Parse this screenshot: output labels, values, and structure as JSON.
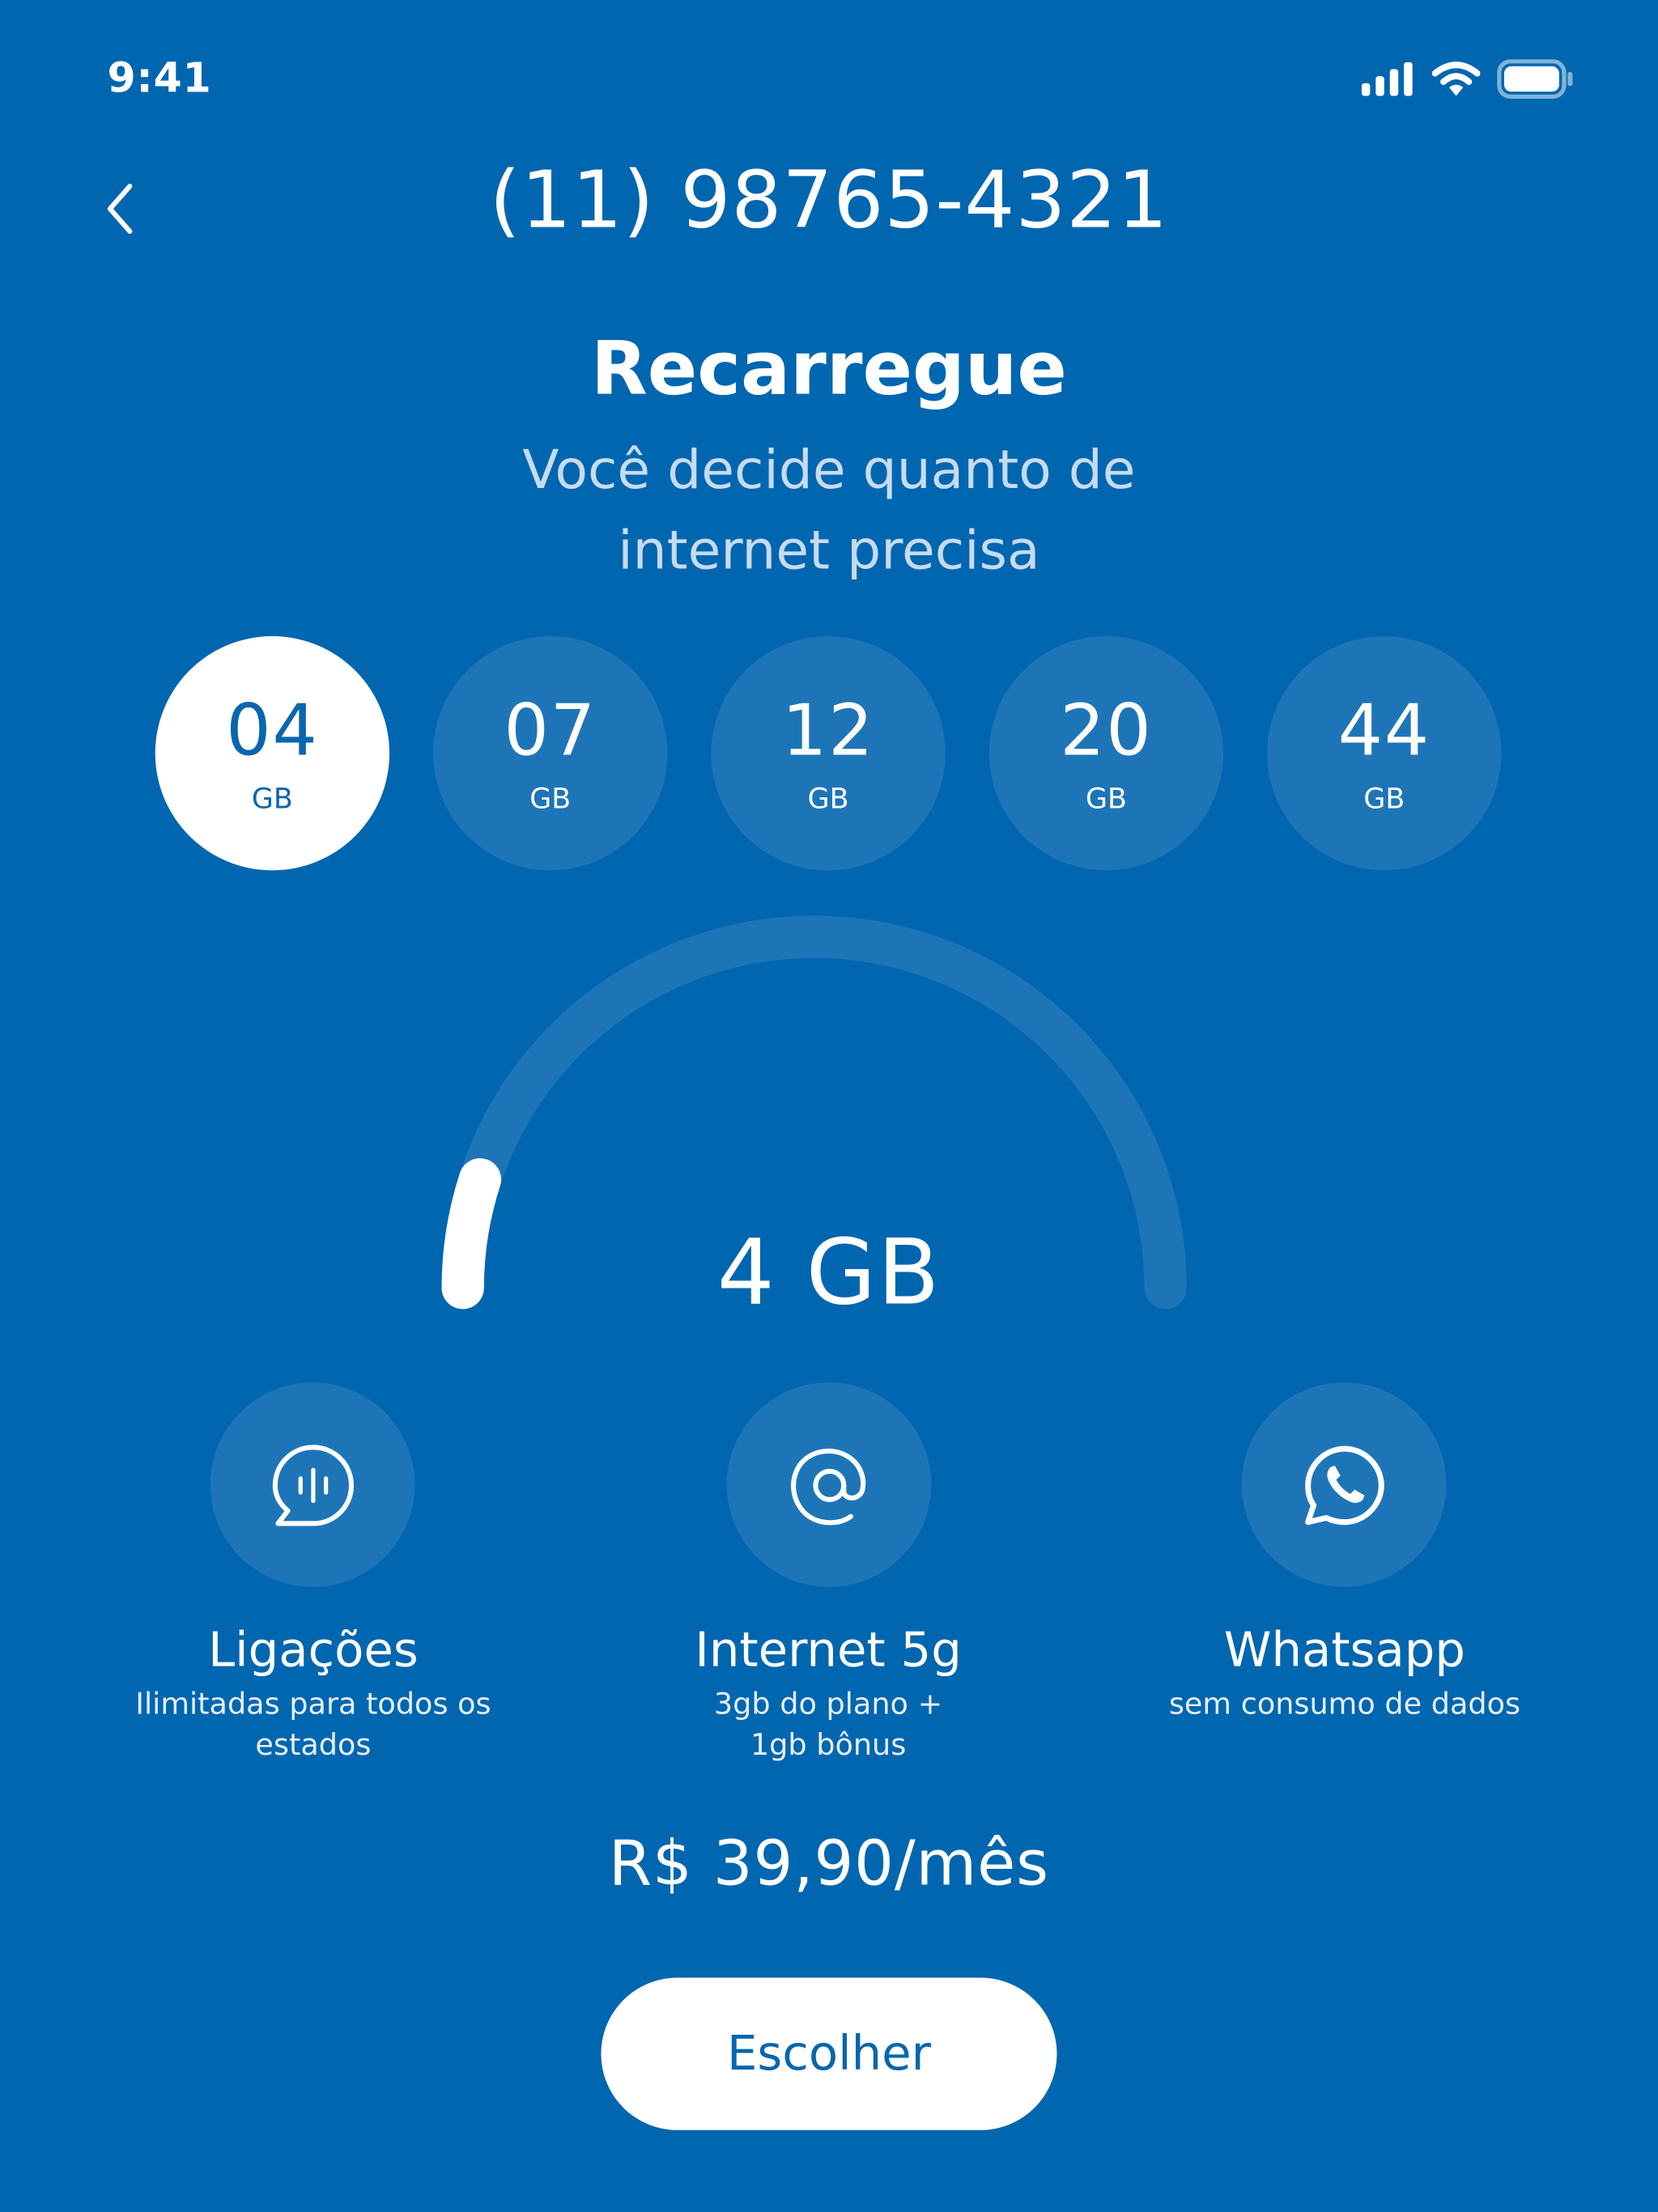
{
  "status_bar": {
    "time": "9:41"
  },
  "header": {
    "title": "(11) 98765-4321"
  },
  "hero": {
    "title": "Recarregue",
    "subtitle": "Você decide quanto de internet precisa"
  },
  "gb_options": [
    {
      "value": "04",
      "unit": "GB",
      "selected": true
    },
    {
      "value": "07",
      "unit": "GB",
      "selected": false
    },
    {
      "value": "12",
      "unit": "GB",
      "selected": false
    },
    {
      "value": "20",
      "unit": "GB",
      "selected": false
    },
    {
      "value": "44",
      "unit": "GB",
      "selected": false
    }
  ],
  "gauge": {
    "value_label": "4 GB",
    "fill_fraction": 0.1
  },
  "features": [
    {
      "icon": "chat-voice-icon",
      "title": "Ligações",
      "description": "Ilimitadas para todos os estados"
    },
    {
      "icon": "at-sign-icon",
      "title": "Internet 5g",
      "description": "3gb do plano + 1gb bônus"
    },
    {
      "icon": "whatsapp-icon",
      "title": "Whatsapp",
      "description": "sem consumo de dados"
    }
  ],
  "price": "R$ 39,90/mês",
  "cta": {
    "label": "Escolher"
  },
  "colors": {
    "background": "#0066b0",
    "circle": "#1d75b8",
    "accent_text": "#0866ad"
  }
}
